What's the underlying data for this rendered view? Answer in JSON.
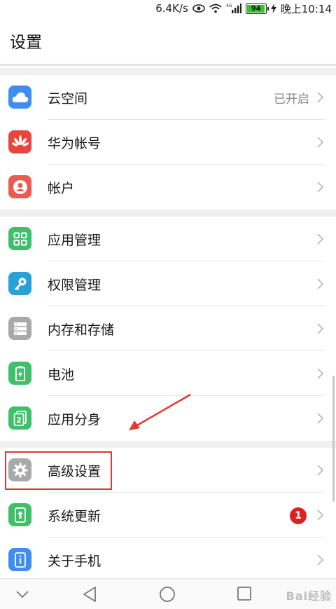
{
  "status_bar": {
    "speed": "6.4K/s",
    "network": "4G",
    "battery": "94",
    "time": "晚上10:14"
  },
  "header": {
    "title": "设置"
  },
  "groups": [
    {
      "items": [
        {
          "label": "云空间",
          "value": "已开启",
          "icon": "cloud-icon",
          "color": "#3d8ef0"
        },
        {
          "label": "华为帐号",
          "icon": "huawei-logo-icon",
          "color": "#e8453c"
        },
        {
          "label": "帐户",
          "icon": "user-icon",
          "color": "#ea5a4e"
        }
      ]
    },
    {
      "items": [
        {
          "label": "应用管理",
          "icon": "grid-icon",
          "color": "#3ec06a"
        },
        {
          "label": "权限管理",
          "icon": "key-icon",
          "color": "#2aa0d8"
        },
        {
          "label": "内存和存储",
          "icon": "storage-icon",
          "color": "#a9a9a9"
        },
        {
          "label": "电池",
          "icon": "battery-icon",
          "color": "#3ec06a"
        },
        {
          "label": "应用分身",
          "icon": "app-twin-icon",
          "color": "#3ec06a"
        }
      ]
    },
    {
      "items": [
        {
          "label": "高级设置",
          "icon": "gear-icon",
          "color": "#a9a9a9"
        },
        {
          "label": "系统更新",
          "badge": "1",
          "icon": "update-icon",
          "color": "#3ec06a"
        },
        {
          "label": "关于手机",
          "icon": "info-icon",
          "color": "#3d8ef0"
        }
      ]
    }
  ],
  "watermark": "Bai经验"
}
